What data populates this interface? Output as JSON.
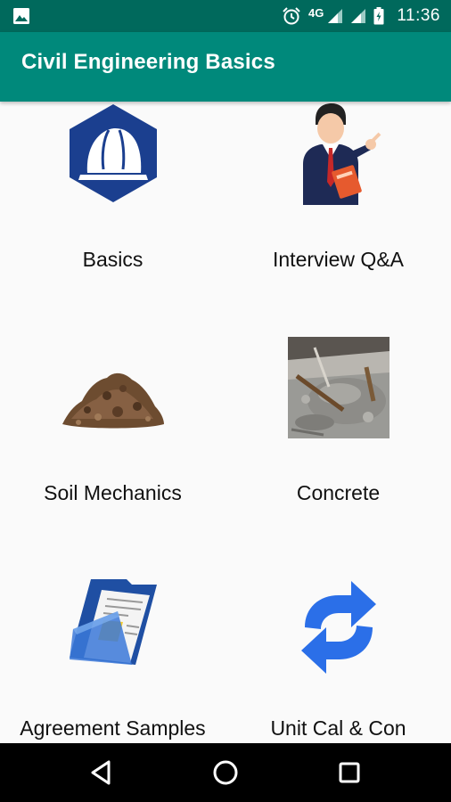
{
  "status_bar": {
    "network": "4G",
    "time": "11:36",
    "icons": [
      "image-icon",
      "alarm-icon",
      "signal-icon",
      "signal-icon",
      "battery-icon"
    ]
  },
  "app_bar": {
    "title": "Civil Engineering Basics",
    "color": "#00897b",
    "status_color": "#00695c"
  },
  "tiles": [
    {
      "label": "Basics",
      "icon": "hard-hat-icon"
    },
    {
      "label": "Interview Q&A",
      "icon": "businessman-icon"
    },
    {
      "label": "Soil Mechanics",
      "icon": "soil-pile-icon"
    },
    {
      "label": "Concrete",
      "icon": "concrete-photo-icon"
    },
    {
      "label": "Agreement Samples",
      "icon": "document-folder-icon"
    },
    {
      "label": "Unit Cal & Con",
      "icon": "convert-arrows-icon"
    }
  ],
  "nav_bar": {
    "buttons": [
      "back-icon",
      "home-icon",
      "recents-icon"
    ]
  }
}
